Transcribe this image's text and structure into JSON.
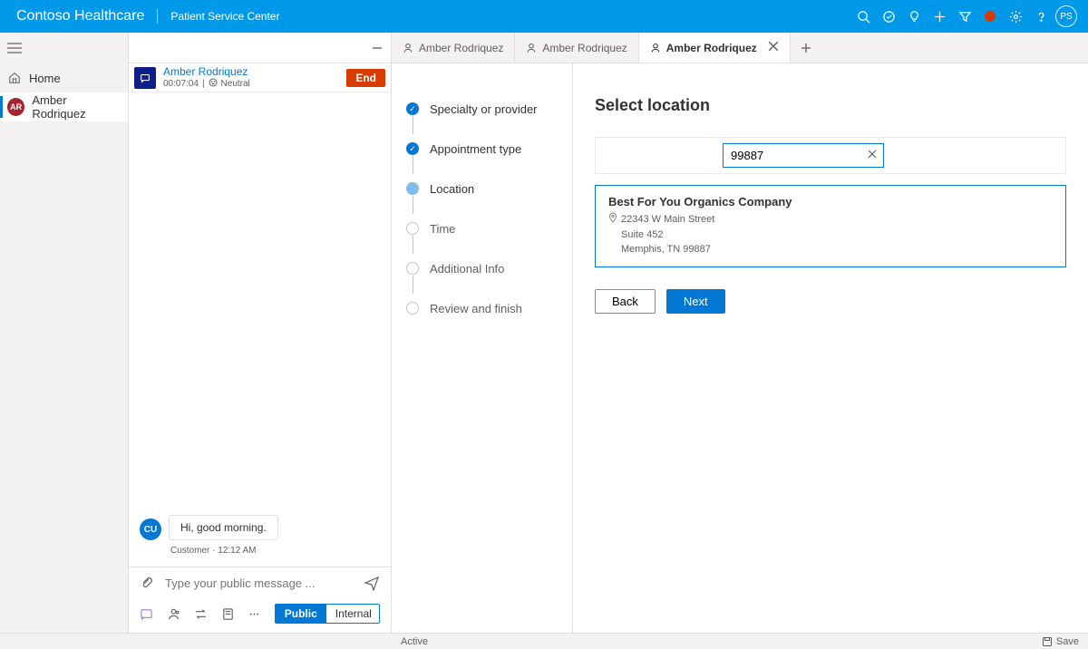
{
  "header": {
    "app_title": "Contoso Healthcare",
    "section": "Patient Service Center",
    "user_initials": "PS"
  },
  "nav": {
    "home_label": "Home",
    "patient_label": "Amber Rodriquez",
    "patient_initials": "AR"
  },
  "convo": {
    "name": "Amber Rodriquez",
    "timer": "00:07:04",
    "sentiment": "Neutral",
    "end_label": "End",
    "message_text": "Hi, good morning.",
    "message_meta": "Customer · 12:12 AM",
    "customer_badge": "CU",
    "compose_placeholder": "Type your public message ...",
    "toggle_public": "Public",
    "toggle_internal": "Internal"
  },
  "tabs": {
    "t0": "Amber Rodriquez",
    "t1": "Amber Rodriquez",
    "t2": "Amber Rodriquez"
  },
  "wizard": {
    "s0": "Specialty or provider",
    "s1": "Appointment type",
    "s2": "Location",
    "s3": "Time",
    "s4": "Additional Info",
    "s5": "Review and finish"
  },
  "form": {
    "heading": "Select location",
    "search_value": "99887",
    "result_title": "Best For You Organics Company",
    "addr_line1": "22343 W Main Street",
    "addr_line2": "Suite 452",
    "addr_line3": "Memphis, TN 99887",
    "back_label": "Back",
    "next_label": "Next"
  },
  "status": {
    "state": "Active",
    "save": "Save"
  }
}
